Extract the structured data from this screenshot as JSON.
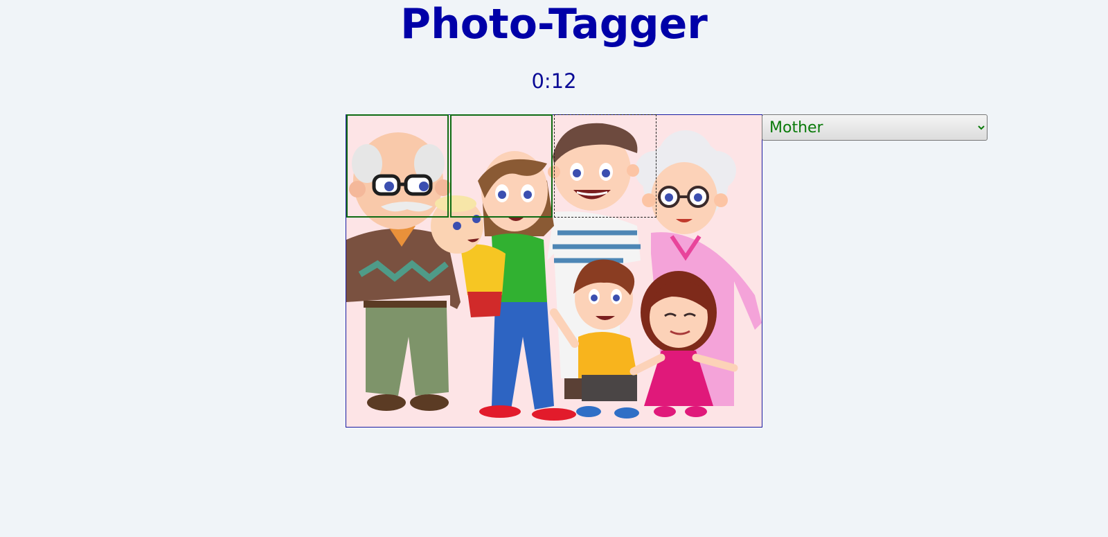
{
  "app": {
    "title": "Photo-Tagger",
    "timer": "0:12"
  },
  "photo": {
    "subject": "cartoon family portrait",
    "background_color": "#fde4e6",
    "frame_color": "#1a1aa0"
  },
  "tag_grid": {
    "completed_boxes": 2,
    "active_box": 3,
    "completed_color": "#0e6b12"
  },
  "person_select": {
    "selected": "Mother",
    "options": [
      "Mother"
    ],
    "text_color": "#0a7a0a"
  },
  "colors": {
    "page_background": "#f0f4f8",
    "title": "#0000a8",
    "timer": "#0a0a96"
  }
}
